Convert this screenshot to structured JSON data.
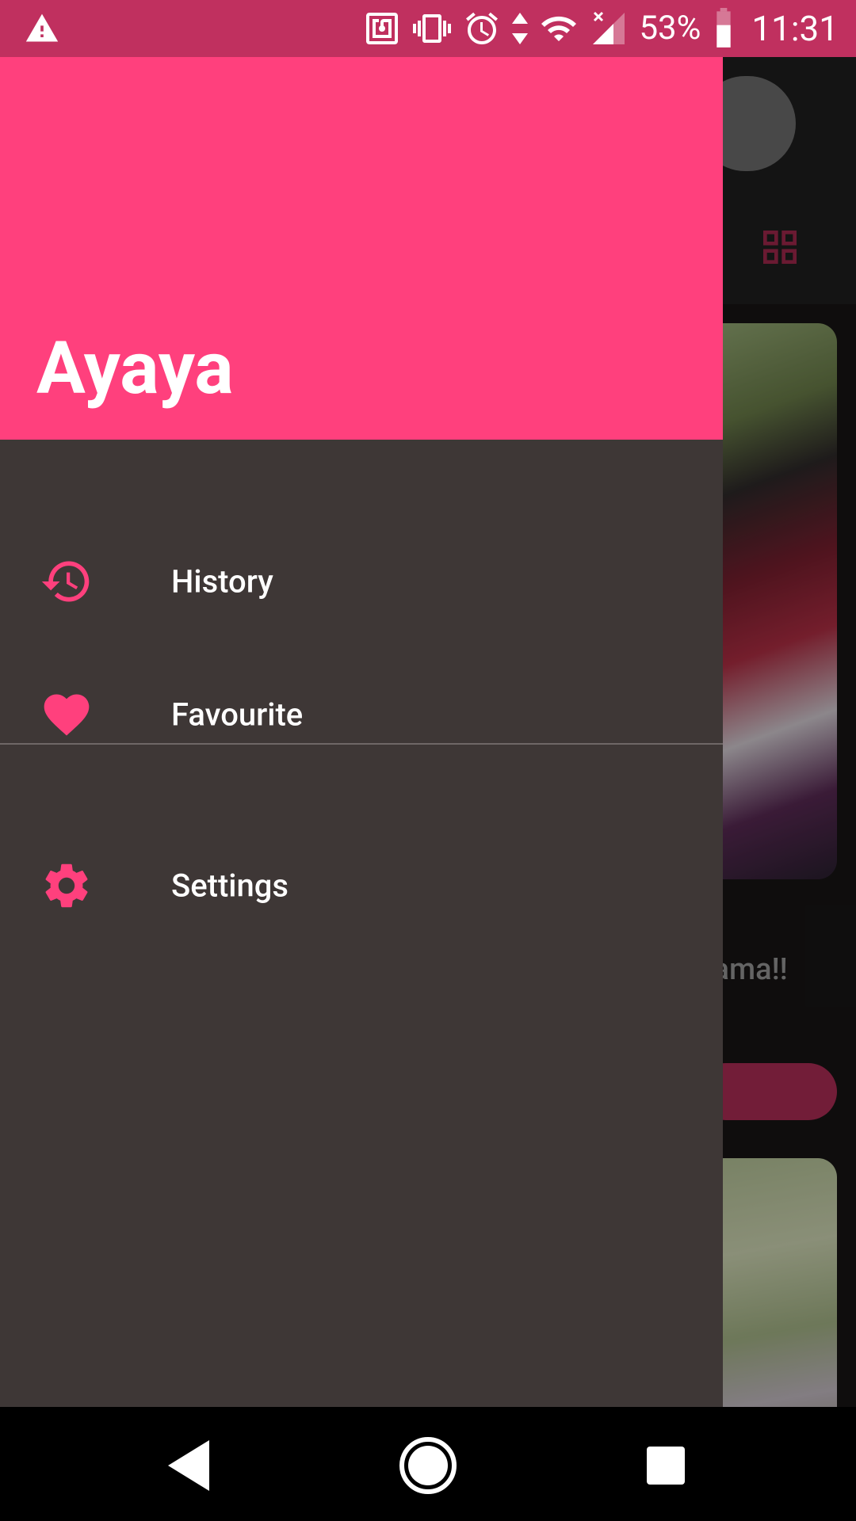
{
  "status_bar": {
    "battery": "53%",
    "time": "11:31",
    "icons": [
      "warning-icon",
      "nfc-icon",
      "vibrate-icon",
      "alarm-icon",
      "data-arrows-icon",
      "wifi-icon",
      "signal-icon",
      "battery-icon"
    ]
  },
  "background": {
    "caption": "sama!!"
  },
  "drawer": {
    "title": "Ayaya",
    "items": [
      {
        "label": "History",
        "icon": "history-icon"
      },
      {
        "label": "Favourite",
        "icon": "heart-icon"
      },
      {
        "label": "Settings",
        "icon": "gear-icon"
      }
    ]
  },
  "navigation": {
    "buttons": [
      "back-icon",
      "home-icon",
      "recents-icon"
    ]
  },
  "colors": {
    "accent": "#ff407d",
    "status_bar": "#c0305f",
    "drawer_bg": "#3e3736"
  }
}
